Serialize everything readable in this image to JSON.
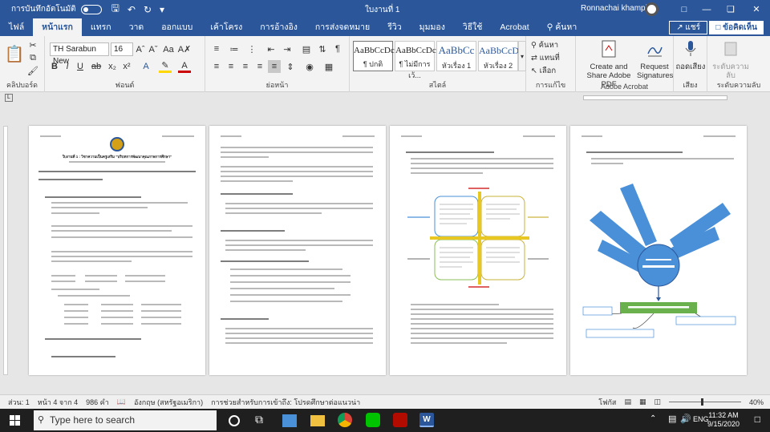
{
  "titlebar": {
    "autosave_label": "การบันทึกอัตโนมัติ",
    "document_title": "ใบงานที่ 1",
    "user_name": "Ronnachai khampin"
  },
  "tabs": {
    "items": [
      "ไฟล์",
      "หน้าแรก",
      "แทรก",
      "วาด",
      "ออกแบบ",
      "เค้าโครง",
      "การอ้างอิง",
      "การส่งจดหมาย",
      "รีวิว",
      "มุมมอง",
      "วิธีใช้",
      "Acrobat",
      "ค้นหา"
    ],
    "active_index": 1,
    "share_label": "แชร์",
    "comments_label": "ข้อคิดเห็น"
  },
  "ribbon": {
    "clipboard_label": "คลิปบอร์ด",
    "font_label": "ฟอนต์",
    "paragraph_label": "ย่อหน้า",
    "styles_label": "สไตล์",
    "editing_label": "การแก้ไข",
    "acrobat_label": "Adobe Acrobat",
    "voice_label": "เสียง",
    "sensitivity_label": "ระดับความลับ",
    "font_name": "TH Sarabun New",
    "font_size": "16",
    "styles": [
      {
        "sample": "AaBbCcDc",
        "name": "¶ ปกติ"
      },
      {
        "sample": "AaBbCcDc",
        "name": "¶ ไม่มีการเว้..."
      },
      {
        "sample": "AaBbCc",
        "name": "หัวเรื่อง 1"
      },
      {
        "sample": "AaBbCcD",
        "name": "หัวเรื่อง 2"
      }
    ],
    "find_label": "ค้นหา",
    "replace_label": "แทนที่",
    "select_label": "เลือก",
    "create_pdf_label": "Create and Share Adobe PDF",
    "request_sig_label": "Request Signatures",
    "dictate_label": "ถอดเสียง",
    "sensitivity_btn_label": "ระดับความลับ"
  },
  "pages": {
    "page1_title": "ใบงานที่ 1 : วิชาความเป็นครูเสริม \"บริบทการพัฒนาคุณภาพการศึกษา\""
  },
  "status": {
    "section": "ส่วน: 1",
    "page": "หน้า 4 จาก 4",
    "words": "986 คำ",
    "language": "อังกฤษ (สหรัฐอเมริกา)",
    "accessibility": "การช่วยสำหรับการเข้าถึง: โปรดศึกษาต่อแนวน่า",
    "focus": "โฟกัส",
    "zoom": "40%"
  },
  "taskbar": {
    "search_placeholder": "Type here to search",
    "time": "11:32 AM",
    "date": "9/15/2020",
    "lang": "ENG"
  },
  "colors": {
    "word_blue": "#2b579a",
    "mindmap_blue": "#4a90d9"
  }
}
